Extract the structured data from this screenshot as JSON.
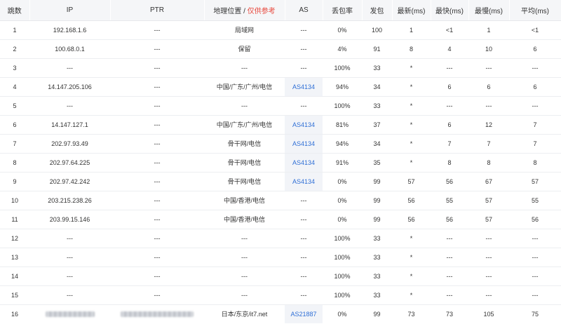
{
  "headers": {
    "hop": "跳数",
    "ip": "IP",
    "ptr": "PTR",
    "geo": "地理位置",
    "geo_sep": " / ",
    "geo_note": "仅供参考",
    "as": "AS",
    "loss": "丢包率",
    "sent": "发包",
    "last": "最新(ms)",
    "best": "最快(ms)",
    "worst": "最慢(ms)",
    "avg": "平均(ms)"
  },
  "colors": {
    "header_bg": "#f5f6f8",
    "link": "#2f6fd6",
    "warn": "#e8473b"
  },
  "rows": [
    {
      "hop": "1",
      "ip": "192.168.1.6",
      "ptr": "---",
      "geo": "局域网",
      "as": "---",
      "loss": "0%",
      "sent": "100",
      "last": "1",
      "best": "<1",
      "worst": "1",
      "avg": "<1"
    },
    {
      "hop": "2",
      "ip": "100.68.0.1",
      "ptr": "---",
      "geo": "保留",
      "as": "---",
      "loss": "4%",
      "sent": "91",
      "last": "8",
      "best": "4",
      "worst": "10",
      "avg": "6"
    },
    {
      "hop": "3",
      "ip": "---",
      "ptr": "---",
      "geo": "---",
      "as": "---",
      "loss": "100%",
      "sent": "33",
      "last": "*",
      "best": "---",
      "worst": "---",
      "avg": "---"
    },
    {
      "hop": "4",
      "ip": "14.147.205.106",
      "ptr": "---",
      "geo": "中国/广东/广州/电信",
      "as": "AS4134",
      "loss": "94%",
      "sent": "34",
      "last": "*",
      "best": "6",
      "worst": "6",
      "avg": "6"
    },
    {
      "hop": "5",
      "ip": "---",
      "ptr": "---",
      "geo": "---",
      "as": "---",
      "loss": "100%",
      "sent": "33",
      "last": "*",
      "best": "---",
      "worst": "---",
      "avg": "---"
    },
    {
      "hop": "6",
      "ip": "14.147.127.1",
      "ptr": "---",
      "geo": "中国/广东/广州/电信",
      "as": "AS4134",
      "loss": "81%",
      "sent": "37",
      "last": "*",
      "best": "6",
      "worst": "12",
      "avg": "7"
    },
    {
      "hop": "7",
      "ip": "202.97.93.49",
      "ptr": "---",
      "geo": "骨干网/电信",
      "as": "AS4134",
      "loss": "94%",
      "sent": "34",
      "last": "*",
      "best": "7",
      "worst": "7",
      "avg": "7"
    },
    {
      "hop": "8",
      "ip": "202.97.64.225",
      "ptr": "---",
      "geo": "骨干网/电信",
      "as": "AS4134",
      "loss": "91%",
      "sent": "35",
      "last": "*",
      "best": "8",
      "worst": "8",
      "avg": "8"
    },
    {
      "hop": "9",
      "ip": "202.97.42.242",
      "ptr": "---",
      "geo": "骨干网/电信",
      "as": "AS4134",
      "loss": "0%",
      "sent": "99",
      "last": "57",
      "best": "56",
      "worst": "67",
      "avg": "57"
    },
    {
      "hop": "10",
      "ip": "203.215.238.26",
      "ptr": "---",
      "geo": "中国/香港/电信",
      "as": "---",
      "loss": "0%",
      "sent": "99",
      "last": "56",
      "best": "55",
      "worst": "57",
      "avg": "55"
    },
    {
      "hop": "11",
      "ip": "203.99.15.146",
      "ptr": "---",
      "geo": "中国/香港/电信",
      "as": "---",
      "loss": "0%",
      "sent": "99",
      "last": "56",
      "best": "56",
      "worst": "57",
      "avg": "56"
    },
    {
      "hop": "12",
      "ip": "---",
      "ptr": "---",
      "geo": "---",
      "as": "---",
      "loss": "100%",
      "sent": "33",
      "last": "*",
      "best": "---",
      "worst": "---",
      "avg": "---"
    },
    {
      "hop": "13",
      "ip": "---",
      "ptr": "---",
      "geo": "---",
      "as": "---",
      "loss": "100%",
      "sent": "33",
      "last": "*",
      "best": "---",
      "worst": "---",
      "avg": "---"
    },
    {
      "hop": "14",
      "ip": "---",
      "ptr": "---",
      "geo": "---",
      "as": "---",
      "loss": "100%",
      "sent": "33",
      "last": "*",
      "best": "---",
      "worst": "---",
      "avg": "---"
    },
    {
      "hop": "15",
      "ip": "---",
      "ptr": "---",
      "geo": "---",
      "as": "---",
      "loss": "100%",
      "sent": "33",
      "last": "*",
      "best": "---",
      "worst": "---",
      "avg": "---"
    },
    {
      "hop": "16",
      "ip": "",
      "ptr": "",
      "geo": "日本/东京/it7.net",
      "as": "AS21887",
      "loss": "0%",
      "sent": "99",
      "last": "73",
      "best": "73",
      "worst": "105",
      "avg": "75",
      "redacted": true
    }
  ]
}
